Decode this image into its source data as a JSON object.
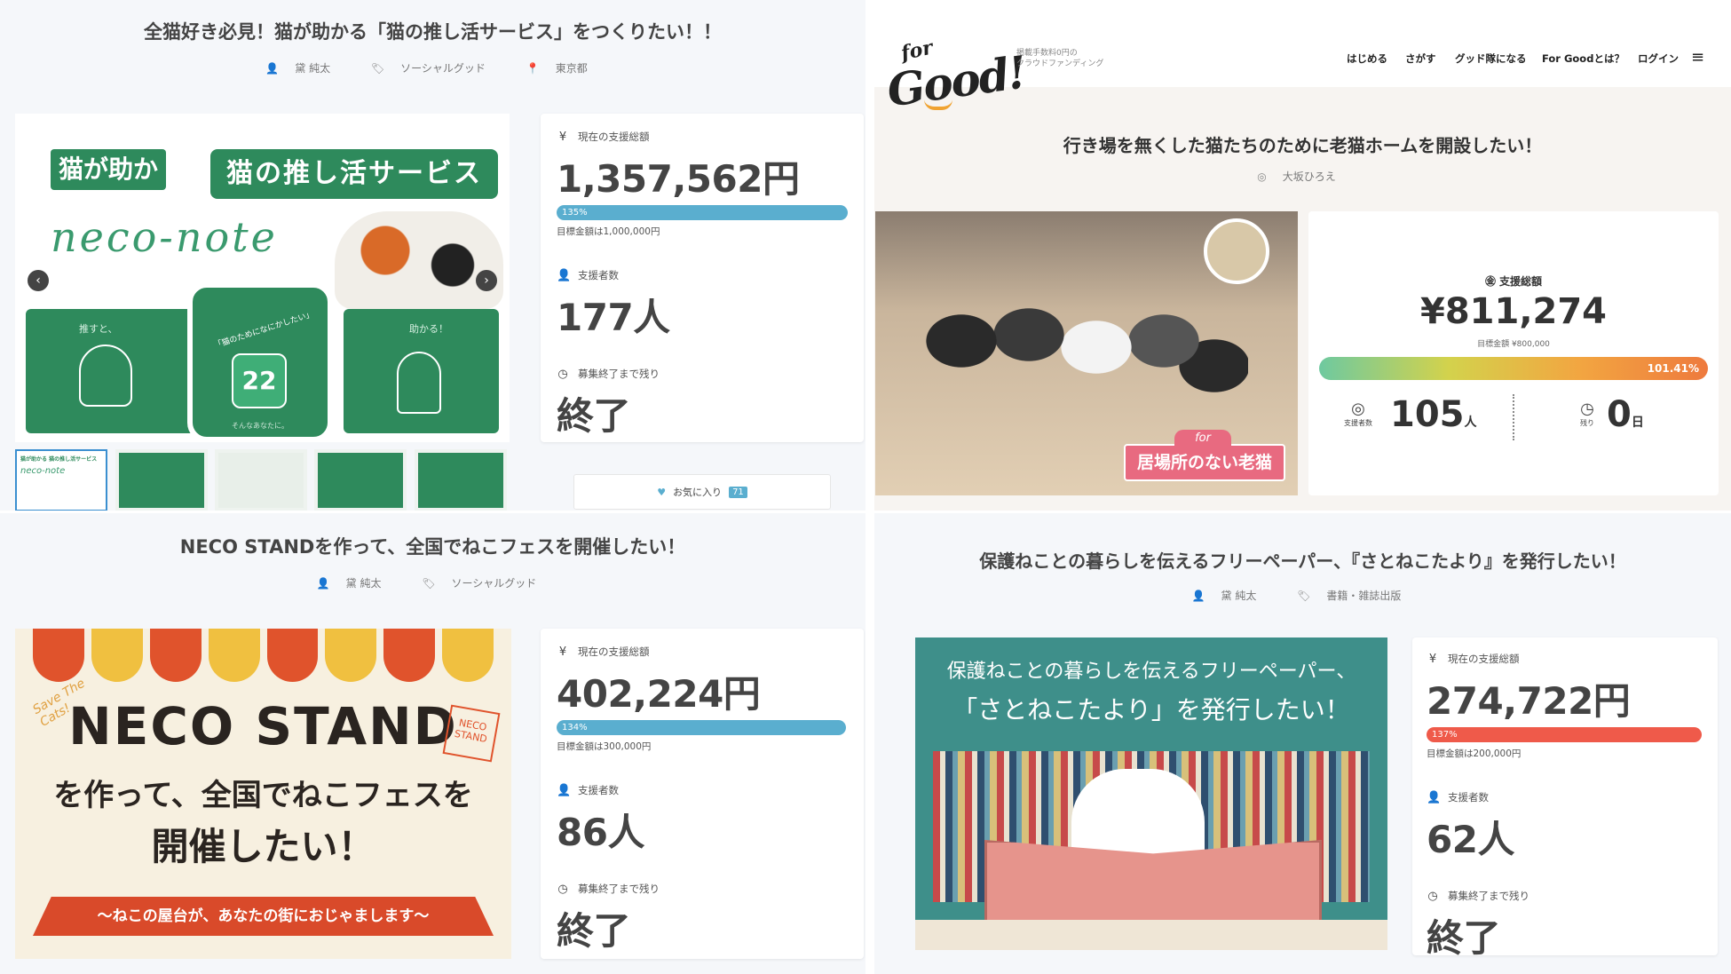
{
  "p1": {
    "title": "全猫好き必見！猫が助かる「猫の推し活サービス」をつくりたい！！",
    "author": "黛 純太",
    "category": "ソーシャルグッド",
    "location": "東京都",
    "hero": {
      "tag_left": "猫が助かる",
      "tag_right": "猫の推し活サービス",
      "logo": "neco-note",
      "phone_text": "「猫のためになにかしたい」",
      "phone_caption": "そんなあなたに。",
      "panel_left": "推すと、",
      "panel_right": "助かる！"
    },
    "thumb_text": "猫が助かる 猫の推し活サービス",
    "thumb_logo": "neco-note",
    "amount_label": "現在の支援総額",
    "amount": "1,357,562円",
    "percent": "135%",
    "percent_value": 135,
    "goal": "目標金額は1,000,000円",
    "backers_label": "支援者数",
    "backers": "177人",
    "remaining_label": "募集終了まで残り",
    "remaining": "終了",
    "fav_label": "お気に入り",
    "fav_count": "71",
    "bar_color": "#5aaecf"
  },
  "p2": {
    "logo_top": "for",
    "logo_main": "Good!",
    "tagline_1": "掲載手数料0円の",
    "tagline_2": "クラウドファンディング",
    "nav": [
      "はじめる",
      "さがす",
      "グッド隊になる",
      "For Goodとは？",
      "ログイン"
    ],
    "title": "行き場を無くした猫たちのために老猫ホームを開設したい！",
    "author": "大坂ひろえ",
    "badge_for": "for",
    "badge_text": "居場所のない老猫",
    "amount_label": "支援総額",
    "amount": "¥811,274",
    "goal": "目標金額 ¥800,000",
    "percent": "101.41%",
    "percent_value": 101.41,
    "backers_label": "支援者数",
    "backers": "105",
    "backers_unit": "人",
    "remaining_label": "残り",
    "remaining": "0",
    "remaining_unit": "日"
  },
  "p3": {
    "title": "NECO STANDを作って、全国でねこフェスを開催したい！",
    "author": "黛 純太",
    "category": "ソーシャルグッド",
    "hero": {
      "line1": "NECO STAND",
      "line2": "を作って、全国でねこフェスを",
      "line3": "開催したい！",
      "ribbon": "〜ねこの屋台が、あなたの街におじゃまします〜",
      "stamp": "NECO STAND",
      "script": "Save The Cats!"
    },
    "amount_label": "現在の支援総額",
    "amount": "402,224円",
    "percent": "134%",
    "percent_value": 134,
    "goal": "目標金額は300,000円",
    "backers_label": "支援者数",
    "backers": "86人",
    "remaining_label": "募集終了まで残り",
    "remaining": "終了",
    "bar_color": "#5aaecf"
  },
  "p4": {
    "title": "保護ねことの暮らしを伝えるフリーペーパー、『さとねこたより』を発行したい！",
    "author": "黛 純太",
    "category": "書籍・雑誌出版",
    "hero": {
      "line1": "保護ねことの暮らしを伝えるフリーペーパー、",
      "line2": "「さとねこたより」を発行したい！"
    },
    "amount_label": "現在の支援総額",
    "amount": "274,722円",
    "percent": "137%",
    "percent_value": 137,
    "goal": "目標金額は200,000円",
    "backers_label": "支援者数",
    "backers": "62人",
    "remaining_label": "募集終了まで残り",
    "remaining": "終了",
    "bar_color": "#ef5a4a"
  }
}
